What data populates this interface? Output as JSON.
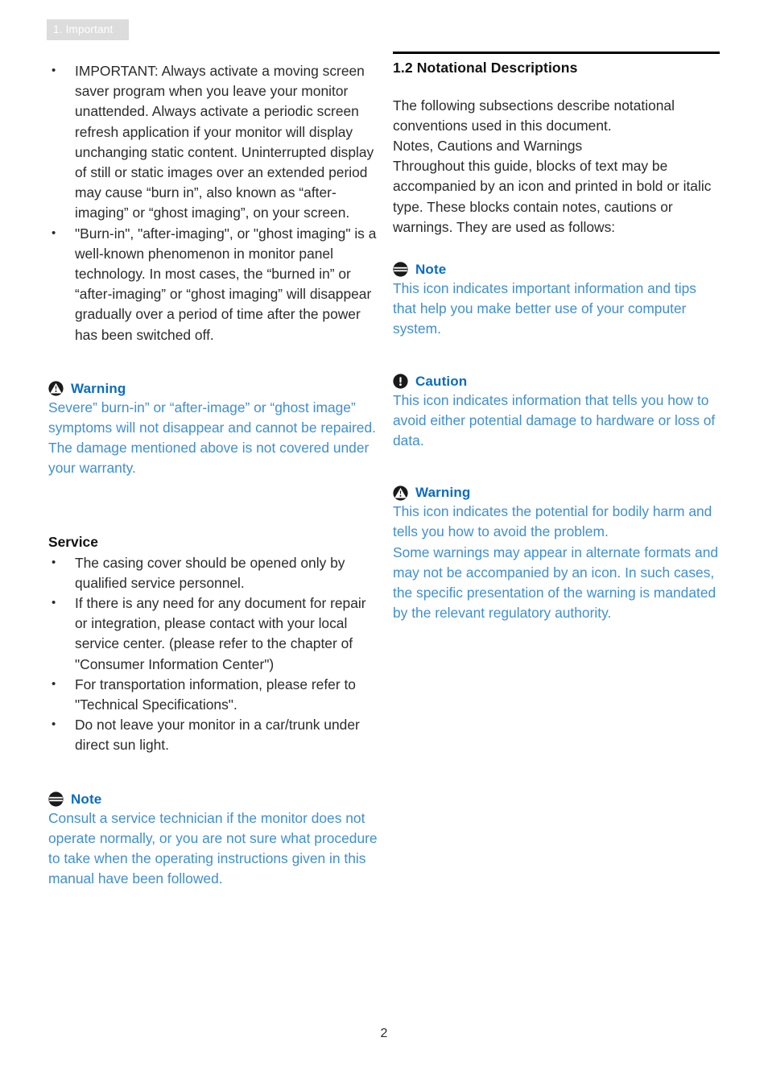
{
  "header": {
    "tab_label": "1. Important"
  },
  "left_column": {
    "bullets": [
      "IMPORTANT: Always activate a moving screen saver program when you leave your monitor unattended. Always activate a periodic screen refresh application if your monitor will display unchanging static content. Uninterrupted display of still or static images over an extended period may cause “burn in”, also known as “after-imaging” or “ghost imaging”, on your screen.",
      "\"Burn-in\", \"after-imaging\", or \"ghost imaging\" is a well-known phenomenon in monitor panel technology. In most cases, the “burned in” or “after-imaging” or “ghost imaging” will disappear gradually over a period of time after the power has been switched off."
    ],
    "warning": {
      "icon": "warning-triangle-icon",
      "label": "Warning",
      "body": "Severe” burn-in” or “after-image” or “ghost image” symptoms will not disappear and cannot be repaired. The damage mentioned above is not covered under your warranty."
    },
    "service": {
      "heading": "Service",
      "bullets": [
        "The casing cover should be opened only by qualified service personnel.",
        "If there is any need for any document for repair or integration, please contact with your local service center. (please refer to the chapter of \"Consumer Information Center\")",
        "For transportation information, please refer to \"Technical Specifications\".",
        "Do not leave your monitor in a car/trunk under direct sun light."
      ]
    },
    "note": {
      "icon": "note-lines-icon",
      "label": "Note",
      "body": "Consult a service technician if the monitor does not operate normally, or you are not sure what procedure to take when the operating instructions given in this manual have been followed."
    }
  },
  "right_column": {
    "section_number_title": "1.2 Notational Descriptions",
    "intro_paragraphs": [
      "The following subsections describe notational conventions used in this document.",
      "Notes, Cautions and Warnings",
      "Throughout this guide, blocks of text may be accompanied by an icon and printed in bold or italic type. These blocks contain notes, cautions or warnings. They are used as follows:"
    ],
    "note": {
      "icon": "note-lines-icon",
      "label": "Note",
      "body": "This icon indicates important information and tips that help you make better use of your computer system."
    },
    "caution": {
      "icon": "caution-exclamation-icon",
      "label": "Caution",
      "body": "This icon indicates information that tells you how to avoid either potential damage to hardware or loss of data."
    },
    "warning": {
      "icon": "warning-triangle-icon",
      "label": "Warning",
      "body_1": "This icon indicates the potential for bodily harm and tells you how to avoid the problem.",
      "body_2": "Some warnings may appear in alternate formats and may not be accompanied by an icon. In such cases, the specific presentation of the warning is mandated by the relevant regulatory authority."
    }
  },
  "footer": {
    "page_number": "2"
  },
  "colors": {
    "heading_blue": "#0a6cc0",
    "body_blue": "#3f8fd1",
    "tab_background": "#dcdcdc",
    "tab_text": "#ffffff",
    "body_text": "#2b2b2b"
  }
}
